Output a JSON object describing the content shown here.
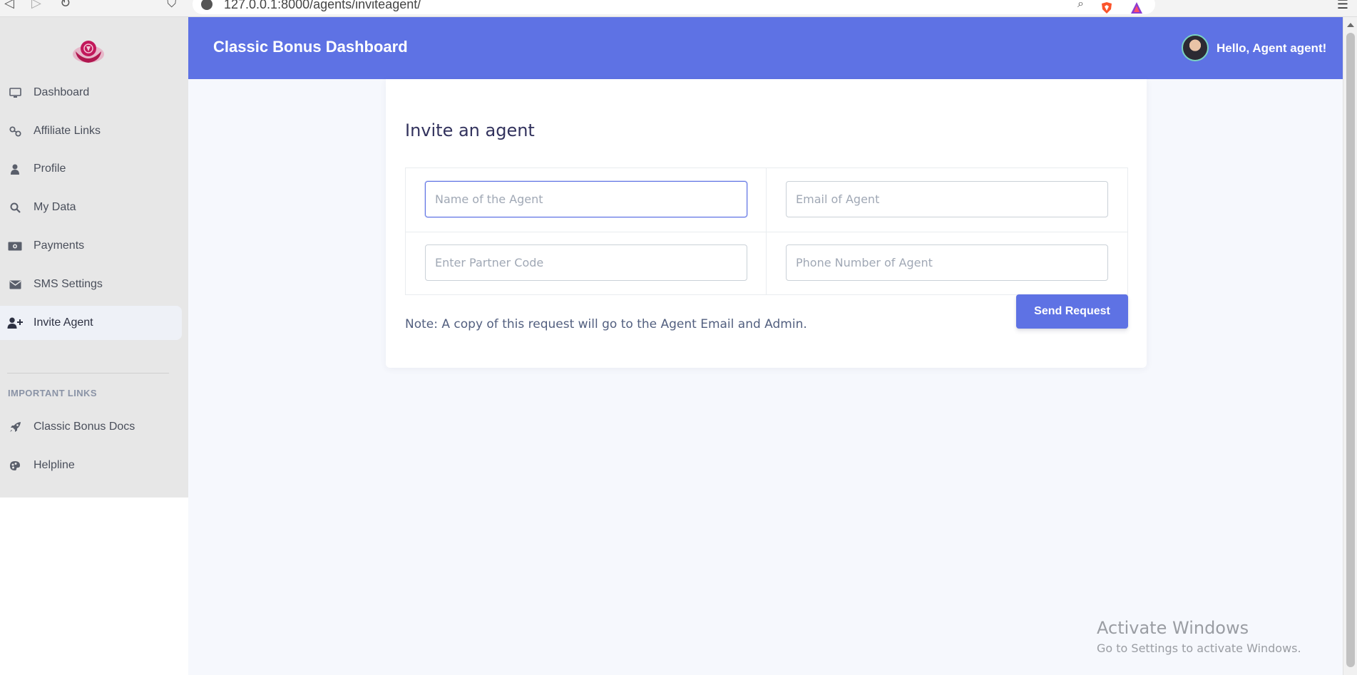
{
  "browser": {
    "url": "127.0.0.1:8000/agents/inviteagent/"
  },
  "header": {
    "title": "Classic Bonus Dashboard",
    "greeting": "Hello, Agent agent!"
  },
  "sidebar": {
    "items": [
      {
        "label": "Dashboard",
        "icon": "monitor-icon"
      },
      {
        "label": "Affiliate Links",
        "icon": "link-icon"
      },
      {
        "label": "Profile",
        "icon": "user-icon"
      },
      {
        "label": "My Data",
        "icon": "search-icon"
      },
      {
        "label": "Payments",
        "icon": "money-icon"
      },
      {
        "label": "SMS Settings",
        "icon": "envelope-icon"
      },
      {
        "label": "Invite Agent",
        "icon": "user-plus-icon",
        "active": true
      }
    ],
    "section_heading": "IMPORTANT LINKS",
    "links": [
      {
        "label": "Classic Bonus Docs",
        "icon": "rocket-icon"
      },
      {
        "label": "Helpline",
        "icon": "palette-icon"
      }
    ]
  },
  "form": {
    "title": "Invite an agent",
    "name_placeholder": "Name of the Agent",
    "email_placeholder": "Email of Agent",
    "partner_code_placeholder": "Enter Partner Code",
    "phone_placeholder": "Phone Number of Agent",
    "submit_label": "Send Request",
    "note": "Note: A copy of this request will go to the Agent Email and Admin."
  },
  "watermark": {
    "title": "Activate Windows",
    "subtitle": "Go to Settings to activate Windows."
  },
  "colors": {
    "primary": "#5e72e4",
    "sidebar_bg": "#e7e7e7",
    "page_bg": "#f6f8fd",
    "brand_logo": "#c2185b"
  }
}
